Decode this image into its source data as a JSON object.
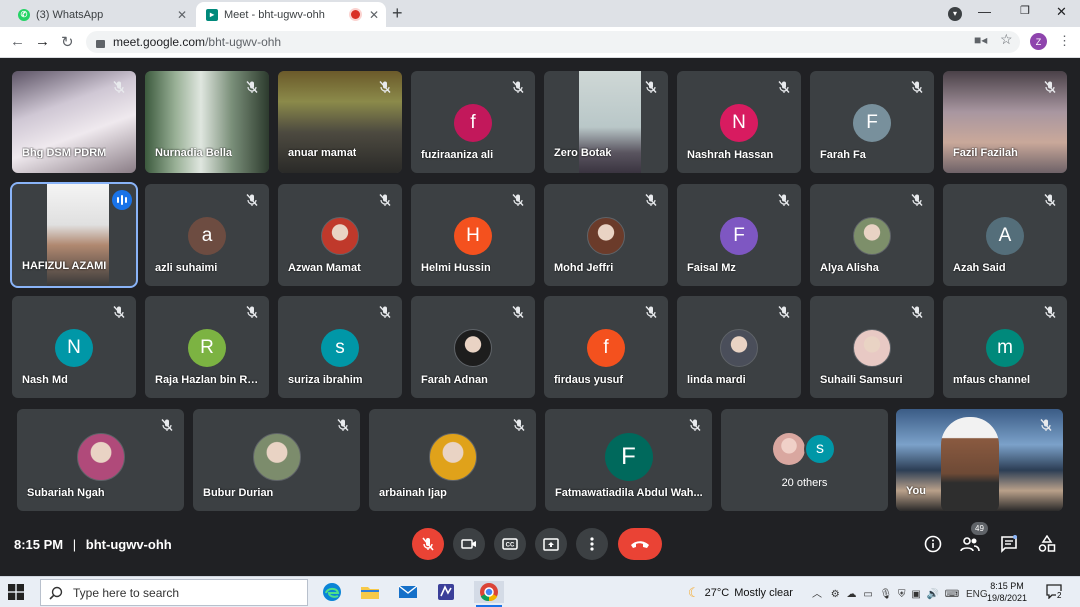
{
  "browser": {
    "tabs": [
      {
        "title": "(3) WhatsApp",
        "icon": "whatsapp-icon"
      },
      {
        "title": "Meet - bht-ugwv-ohh",
        "icon": "google-meet-icon",
        "recording": true
      }
    ],
    "url_host": "meet.google.com",
    "url_path": "/bht-ugwv-ohh",
    "profile_initial": "Z"
  },
  "grid": {
    "row1": [
      {
        "name": "Bhg DSM PDRM",
        "type": "video"
      },
      {
        "name": "Nurnadia Bella",
        "type": "video"
      },
      {
        "name": "anuar mamat",
        "type": "video"
      },
      {
        "name": "fuziraaniza ali",
        "type": "avatar",
        "initial": "f"
      },
      {
        "name": "Zero Botak",
        "type": "video"
      },
      {
        "name": "Nashrah Hassan",
        "type": "avatar",
        "initial": "N"
      },
      {
        "name": "Farah Fa",
        "type": "avatar",
        "initial": "F"
      },
      {
        "name": "Fazil Fazilah",
        "type": "video"
      }
    ],
    "row2": [
      {
        "name": "HAFIZUL AZAMI",
        "type": "video",
        "speaking": true
      },
      {
        "name": "azli suhaimi",
        "type": "avatar",
        "initial": "a"
      },
      {
        "name": "Azwan Mamat",
        "type": "photo-avatar"
      },
      {
        "name": "Helmi Hussin",
        "type": "avatar",
        "initial": "H"
      },
      {
        "name": "Mohd Jeffri",
        "type": "photo-avatar"
      },
      {
        "name": "Faisal Mz",
        "type": "avatar",
        "initial": "F"
      },
      {
        "name": "Alya Alisha",
        "type": "photo-avatar"
      },
      {
        "name": "Azah Said",
        "type": "avatar",
        "initial": "A"
      }
    ],
    "row3": [
      {
        "name": "Nash Md",
        "type": "avatar",
        "initial": "N"
      },
      {
        "name": "Raja Hazlan bin Ra...",
        "type": "avatar",
        "initial": "R"
      },
      {
        "name": "suriza ibrahim",
        "type": "avatar",
        "initial": "s"
      },
      {
        "name": "Farah Adnan",
        "type": "photo-avatar"
      },
      {
        "name": "firdaus yusuf",
        "type": "avatar",
        "initial": "f"
      },
      {
        "name": "linda mardi",
        "type": "photo-avatar"
      },
      {
        "name": "Suhaili Samsuri",
        "type": "photo-avatar"
      },
      {
        "name": "mfaus channel",
        "type": "avatar",
        "initial": "m"
      }
    ],
    "row4": [
      {
        "name": "Subariah Ngah",
        "type": "photo-avatar"
      },
      {
        "name": "Bubur Durian",
        "type": "photo-avatar"
      },
      {
        "name": "arbainah Ijap",
        "type": "photo-avatar"
      },
      {
        "name": "Fatmawatiadila Abdul Wah...",
        "type": "avatar",
        "initial": "F"
      },
      {
        "name": "20 others",
        "type": "others",
        "initial": "s"
      },
      {
        "name": "You",
        "type": "video"
      }
    ]
  },
  "controls": {
    "time": "8:15 PM",
    "separator": "|",
    "meeting_code": "bht-ugwv-ohh",
    "participants_count": "49"
  },
  "taskbar": {
    "search_placeholder": "Type here to search",
    "temperature": "27°C",
    "weather": "Mostly clear",
    "language": "ENG",
    "time": "8:15 PM",
    "date": "19/8/2021",
    "notifications": "2"
  },
  "colors": {
    "background": "#202124",
    "tile": "#3c4043",
    "end_call": "#ea4335",
    "speaking_outline": "#8ab4f8",
    "avatar_colors": {
      "fuziraaniza ali": "#c2185b",
      "Nashrah Hassan": "#d81b60",
      "Farah Fa": "#78909c",
      "azli suhaimi": "#6d4c41",
      "Helmi Hussin": "#f4511e",
      "Faisal Mz": "#7e57c2",
      "Azah Said": "#546e7a",
      "Nash Md": "#0097a7",
      "Raja Hazlan bin Ra...": "#7cb342",
      "suriza ibrahim": "#0097a7",
      "firdaus yusuf": "#f4511e",
      "mfaus channel": "#00897b",
      "Fatmawatiadila Abdul Wah...": "#00695c",
      "20 others": "#0097a7"
    }
  }
}
